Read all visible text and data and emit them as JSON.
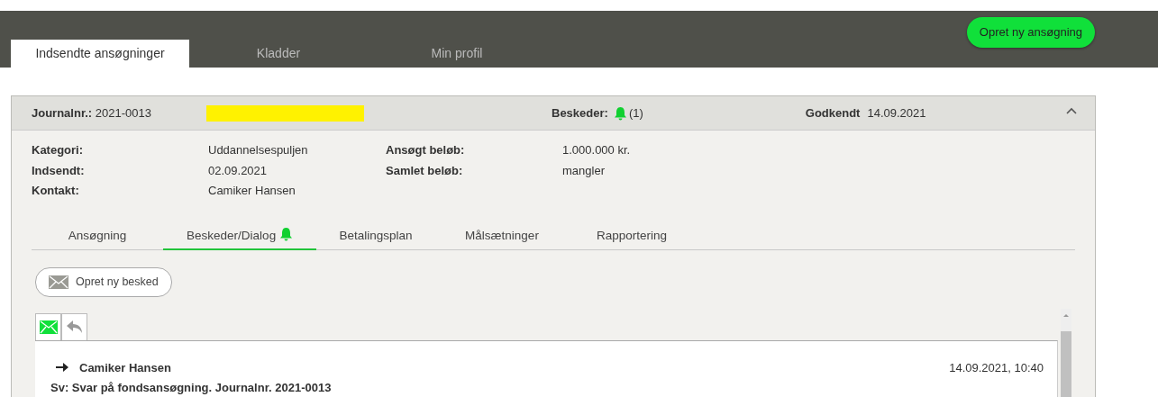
{
  "top_tabs": [
    {
      "label": "Indsendte ansøgninger",
      "selected": true
    },
    {
      "label": "Kladder",
      "selected": false
    },
    {
      "label": "Min profil",
      "selected": false
    }
  ],
  "new_application_button": "Opret ny ansøgning",
  "case": {
    "journal_label": "Journalnr.:",
    "journal_number": "2021-0013",
    "messages_label": "Beskeder:",
    "messages_unread": true,
    "messages_count": "(1)",
    "status_label": "Godkendt",
    "status_date": "14.09.2021",
    "expanded": true,
    "details_left": [
      {
        "label": "Kategori:",
        "value": "Uddannelsespuljen"
      },
      {
        "label": "Indsendt:",
        "value": "02.09.2021"
      },
      {
        "label": "Kontakt:",
        "value": "Camiker Hansen"
      }
    ],
    "details_right": [
      {
        "label": "Ansøgt beløb:",
        "value": "1.000.000 kr."
      },
      {
        "label": "Samlet beløb:",
        "value": "mangler"
      }
    ]
  },
  "sub_tabs": [
    {
      "label": "Ansøgning",
      "selected": false,
      "notification": false
    },
    {
      "label": "Beskeder/Dialog",
      "selected": true,
      "notification": true
    },
    {
      "label": "Betalingsplan",
      "selected": false,
      "notification": false
    },
    {
      "label": "Målsætninger",
      "selected": false,
      "notification": false
    },
    {
      "label": "Rapportering",
      "selected": false,
      "notification": false
    }
  ],
  "new_message_button": "Opret ny besked",
  "message_filters": [
    {
      "kind": "inbox",
      "selected": true
    },
    {
      "kind": "reply",
      "selected": false
    }
  ],
  "messages": [
    {
      "sender": "Camiker Hansen",
      "subject": "Sv: Svar på fondsansøgning. Journalnr. 2021-0013",
      "time": "14.09.2021, 10:40"
    }
  ]
}
